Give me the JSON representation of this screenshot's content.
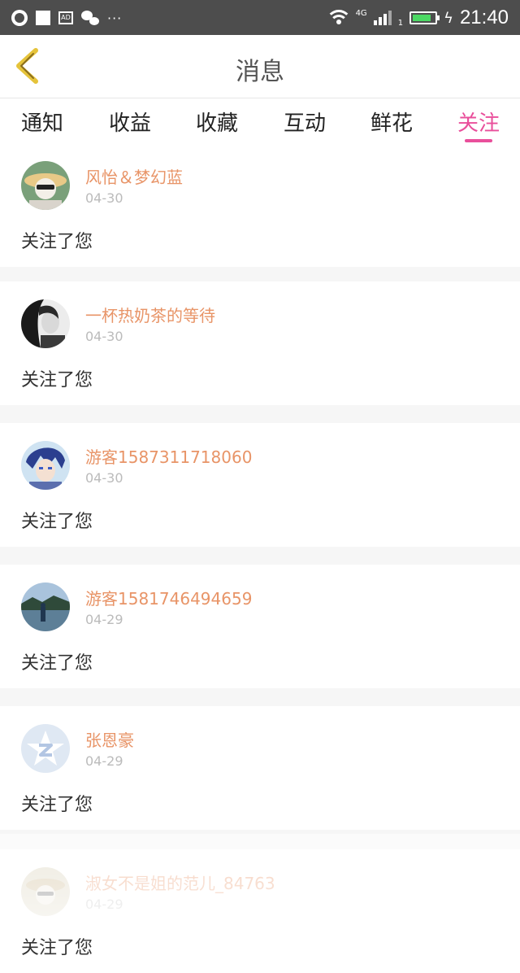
{
  "status_bar": {
    "time": "21:40",
    "network": "4G",
    "sim": "1",
    "icons": [
      "globe-icon",
      "square-icon",
      "ad-icon",
      "wechat-icon",
      "more-dots-icon",
      "wifi-icon",
      "signal-icon",
      "battery-icon",
      "charging-icon"
    ],
    "battery_fill": 0.85
  },
  "header": {
    "title": "消息",
    "back_icon": "chevron-left-icon",
    "accent": "#e5c33a"
  },
  "tabs": [
    {
      "label": "通知",
      "active": false
    },
    {
      "label": "收益",
      "active": false
    },
    {
      "label": "收藏",
      "active": false
    },
    {
      "label": "互动",
      "active": false
    },
    {
      "label": "鲜花",
      "active": false
    },
    {
      "label": "关注",
      "active": true
    }
  ],
  "colors": {
    "active_tab": "#e94f9b",
    "username": "#e89467",
    "date": "#bbbbbb"
  },
  "messages": [
    {
      "name": "风怡＆梦幻蓝",
      "date": "04-30",
      "text": "关注了您",
      "avatar": "avatar-photo"
    },
    {
      "name": "一杯热奶茶的等待",
      "date": "04-30",
      "text": "关注了您",
      "avatar": "avatar-photo"
    },
    {
      "name": "游客1587311718060",
      "date": "04-30",
      "text": "关注了您",
      "avatar": "avatar-photo"
    },
    {
      "name": "游客1581746494659",
      "date": "04-29",
      "text": "关注了您",
      "avatar": "avatar-photo"
    },
    {
      "name": "张恩豪",
      "date": "04-29",
      "text": "关注了您",
      "avatar": "default-avatar-icon"
    },
    {
      "name": "淑女不是姐的范儿_84763",
      "date": "04-29",
      "text": "关注了您",
      "avatar": "avatar-photo"
    }
  ]
}
